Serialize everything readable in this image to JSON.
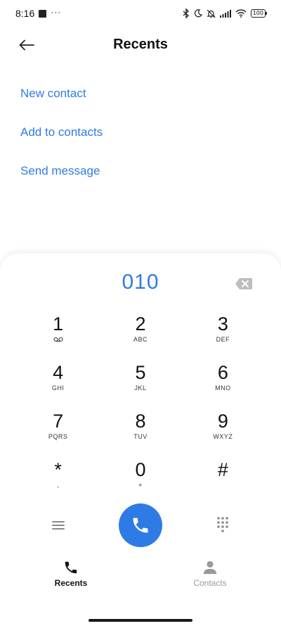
{
  "status_bar": {
    "time": "8:16",
    "dots": "···",
    "battery": "100",
    "icons": [
      "notification-square-icon",
      "bluetooth-icon",
      "moon-icon",
      "bell-off-icon",
      "signal-icon",
      "wifi-icon",
      "battery-icon"
    ]
  },
  "header": {
    "title": "Recents",
    "back_icon": "arrow-left-icon"
  },
  "actions": {
    "new_contact": "New contact",
    "add_to_contacts": "Add to contacts",
    "send_message": "Send message"
  },
  "dialer": {
    "number": "010",
    "backspace_icon": "backspace-icon",
    "keys": [
      {
        "digit": "1",
        "sub": ""
      },
      {
        "digit": "2",
        "sub": "ABC"
      },
      {
        "digit": "3",
        "sub": "DEF"
      },
      {
        "digit": "4",
        "sub": "GHI"
      },
      {
        "digit": "5",
        "sub": "JKL"
      },
      {
        "digit": "6",
        "sub": "MNO"
      },
      {
        "digit": "7",
        "sub": "PQRS"
      },
      {
        "digit": "8",
        "sub": "TUV"
      },
      {
        "digit": "9",
        "sub": "WXYZ"
      },
      {
        "digit": "*",
        "sub": ","
      },
      {
        "digit": "0",
        "sub": "+"
      },
      {
        "digit": "#",
        "sub": ""
      }
    ],
    "accent_color": "#2f7be5"
  },
  "bottom_nav": {
    "recents": "Recents",
    "contacts": "Contacts"
  }
}
